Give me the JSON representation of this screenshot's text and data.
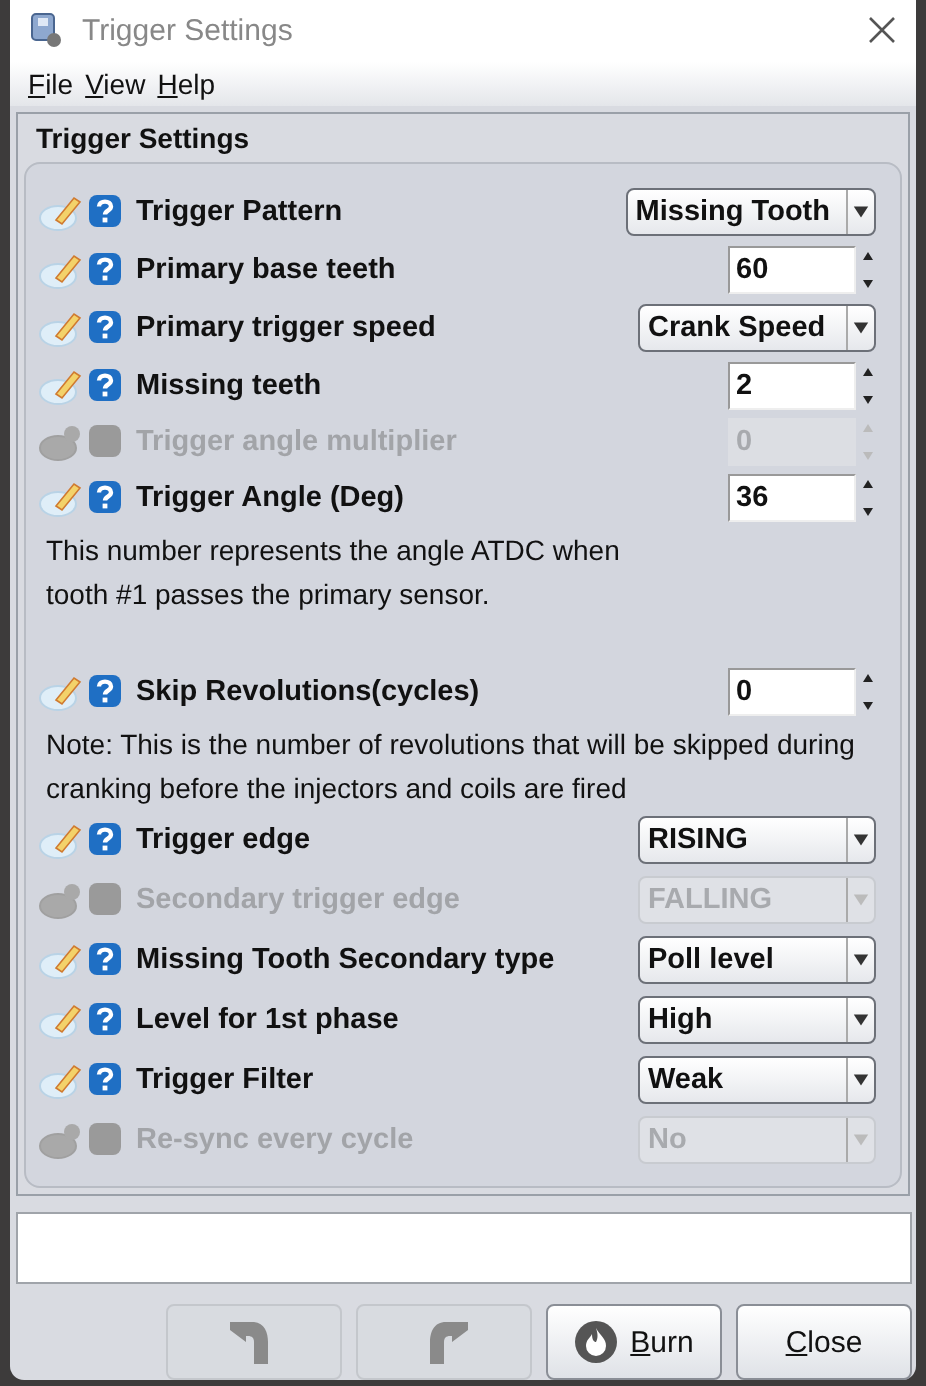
{
  "window": {
    "title": "Trigger Settings"
  },
  "menu": [
    "File",
    "View",
    "Help"
  ],
  "panel": {
    "title": "Trigger Settings"
  },
  "sections": [
    {
      "rows": [
        {
          "kind": "select",
          "label": "Trigger Pattern",
          "value": "Missing Tooth",
          "disabled": false
        },
        {
          "kind": "number",
          "label": "Primary base teeth",
          "value": "60",
          "disabled": false
        },
        {
          "kind": "select",
          "label": "Primary trigger speed",
          "value": "Crank Speed",
          "disabled": false
        },
        {
          "kind": "number",
          "label": "Missing teeth",
          "value": "2",
          "disabled": false
        },
        {
          "kind": "number",
          "label": "Trigger angle multiplier",
          "value": "0",
          "disabled": true
        },
        {
          "kind": "number",
          "label": "Trigger Angle (Deg)",
          "value": "36",
          "disabled": false
        },
        {
          "kind": "note",
          "text": "This number represents the angle ATDC when tooth #1 passes the primary sensor."
        }
      ]
    },
    {
      "rows": [
        {
          "kind": "number",
          "label": "Skip Revolutions(cycles)",
          "value": "0",
          "disabled": false
        },
        {
          "kind": "note",
          "text": "Note: This is the number of revolutions that will be skipped during cranking before the injectors and coils are fired"
        },
        {
          "kind": "select",
          "label": "Trigger edge",
          "value": "RISING",
          "disabled": false
        },
        {
          "kind": "select",
          "label": "Secondary trigger edge",
          "value": "FALLING",
          "disabled": true
        },
        {
          "kind": "select",
          "label": "Missing Tooth Secondary type",
          "value": "Poll level",
          "disabled": false
        },
        {
          "kind": "select",
          "label": "Level for 1st phase",
          "value": "High",
          "disabled": false
        },
        {
          "kind": "select",
          "label": "Trigger Filter",
          "value": "Weak",
          "disabled": false
        },
        {
          "kind": "select",
          "label": "Re-sync every cycle",
          "value": "No",
          "disabled": true
        }
      ]
    }
  ],
  "buttons": [
    {
      "kind": "undo",
      "disabled": true
    },
    {
      "kind": "redo",
      "disabled": true
    },
    {
      "kind": "burn",
      "label": "Burn",
      "disabled": false
    },
    {
      "kind": "close",
      "label": "Close",
      "disabled": false
    }
  ]
}
